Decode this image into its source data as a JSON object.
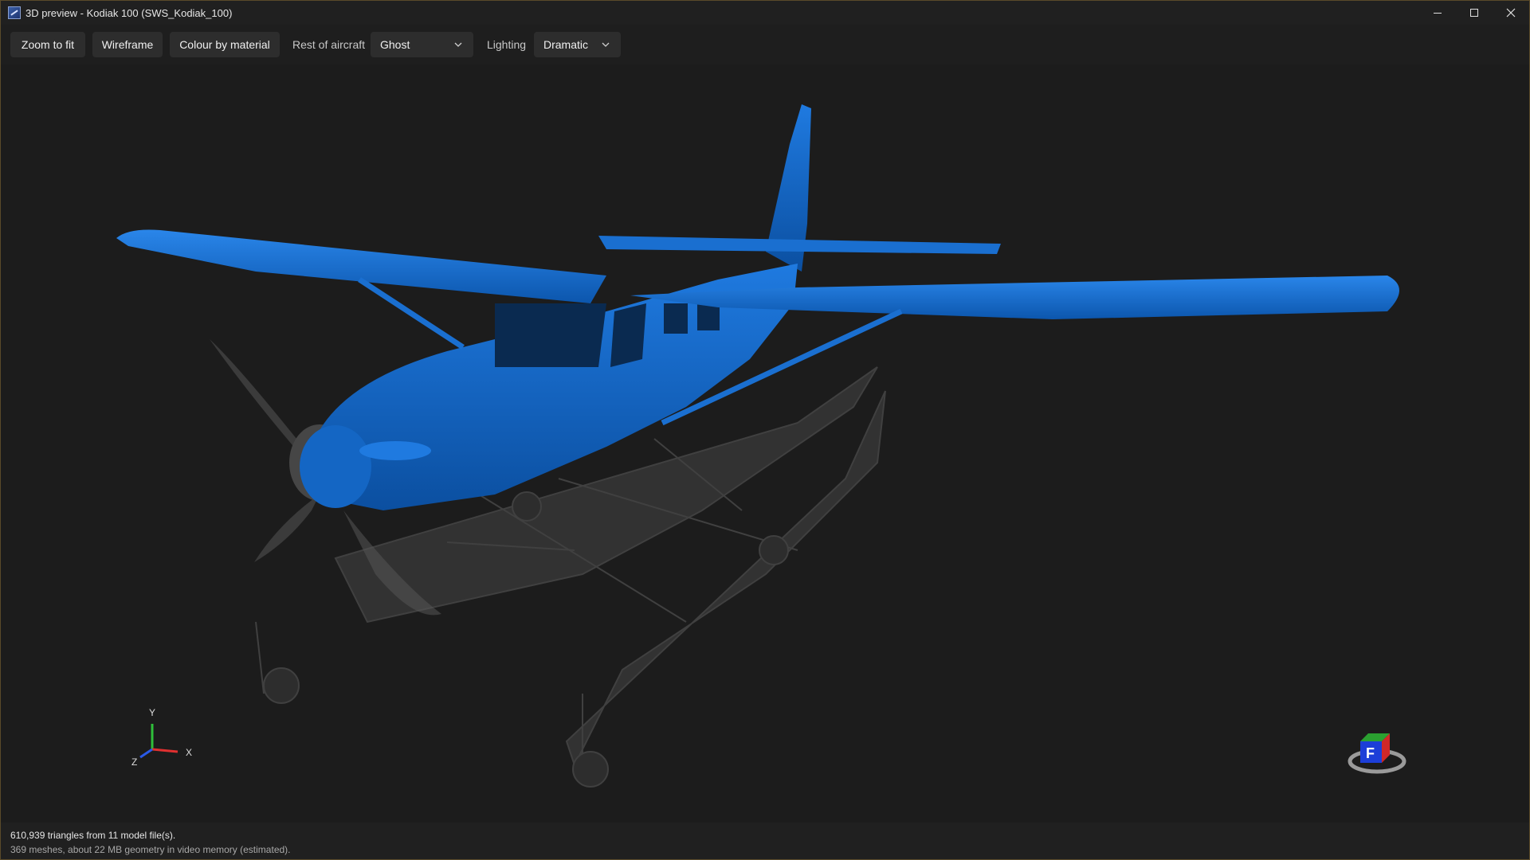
{
  "window": {
    "title": "3D preview - Kodiak 100 (SWS_Kodiak_100)",
    "controls": [
      "minimize-icon",
      "maximize-icon",
      "close-icon"
    ]
  },
  "toolbar": {
    "zoom_to_fit_label": "Zoom to fit",
    "wireframe_label": "Wireframe",
    "colour_by_material_label": "Colour by material",
    "rest_of_aircraft_label": "Rest of aircraft",
    "rest_of_aircraft_value": "Ghost",
    "lighting_label": "Lighting",
    "lighting_value": "Dramatic"
  },
  "viewport": {
    "model_color": "#0f64c0",
    "ghost_color": "#4a4a4a",
    "axis_gizmo": {
      "x_label": "X",
      "y_label": "Y",
      "z_label": "Z"
    },
    "view_cube_label": "F"
  },
  "status": {
    "line1": "610,939 triangles from 11 model file(s).",
    "line2": "369 meshes, about 22 MB geometry in video memory (estimated)."
  }
}
